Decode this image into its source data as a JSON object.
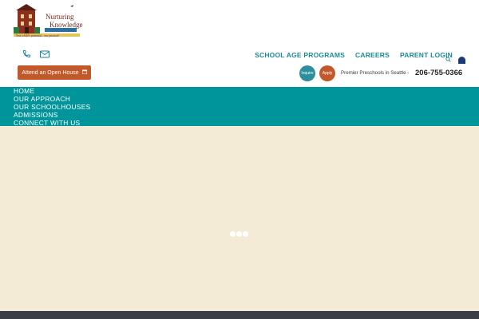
{
  "logo": {
    "line1": "Nurturing",
    "line2": "Knowledge",
    "tagline": "Your child's potential...our passion!"
  },
  "header": {
    "open_house_label": "Attend an Open House",
    "top_nav": [
      "SCHOOL AGE PROGRAMS",
      "CAREERS",
      "PARENT LOGIN"
    ],
    "inquire_label": "Inquire",
    "apply_label": "Apply",
    "tagline": "Premier Preschools in Seattle -",
    "phone": "206-755-0366"
  },
  "main_nav": [
    "HOME",
    "OUR APPROACH",
    "OUR SCHOOLHOUSES",
    "ADMISSIONS",
    "CONNECT WITH US"
  ],
  "colors": {
    "teal": "#00959a",
    "orange": "#c1592b",
    "cream": "#f3ebd6",
    "footer": "#3b3e47"
  },
  "icons": [
    "phone-icon",
    "email-icon",
    "calendar-icon",
    "search-icon"
  ]
}
